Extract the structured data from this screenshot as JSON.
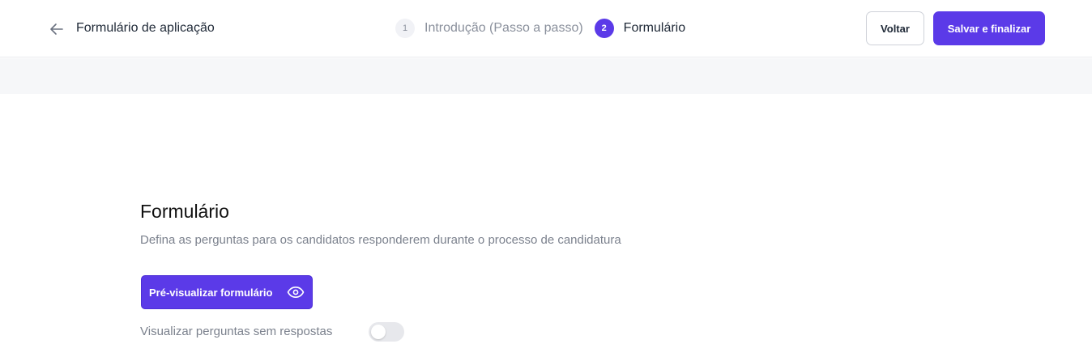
{
  "header": {
    "back_icon": "arrow-left-icon",
    "title": "Formulário de aplicação"
  },
  "stepper": {
    "steps": [
      {
        "number": "1",
        "label": "Introdução (Passo a passo)",
        "active": false
      },
      {
        "number": "2",
        "label": "Formulário",
        "active": true
      }
    ]
  },
  "actions": {
    "back_label": "Voltar",
    "save_label": "Salvar e finalizar"
  },
  "main": {
    "title": "Formulário",
    "subtitle": "Defina as perguntas para os candidatos responderem durante o processo de candidatura",
    "preview_button_label": "Pré-visualizar formulário",
    "preview_icon": "eye-icon",
    "toggle_label": "Visualizar perguntas sem respostas",
    "toggle_on": false
  },
  "colors": {
    "accent": "#5b3ae8",
    "muted_text": "#7b818d",
    "band": "#f6f7f9"
  }
}
